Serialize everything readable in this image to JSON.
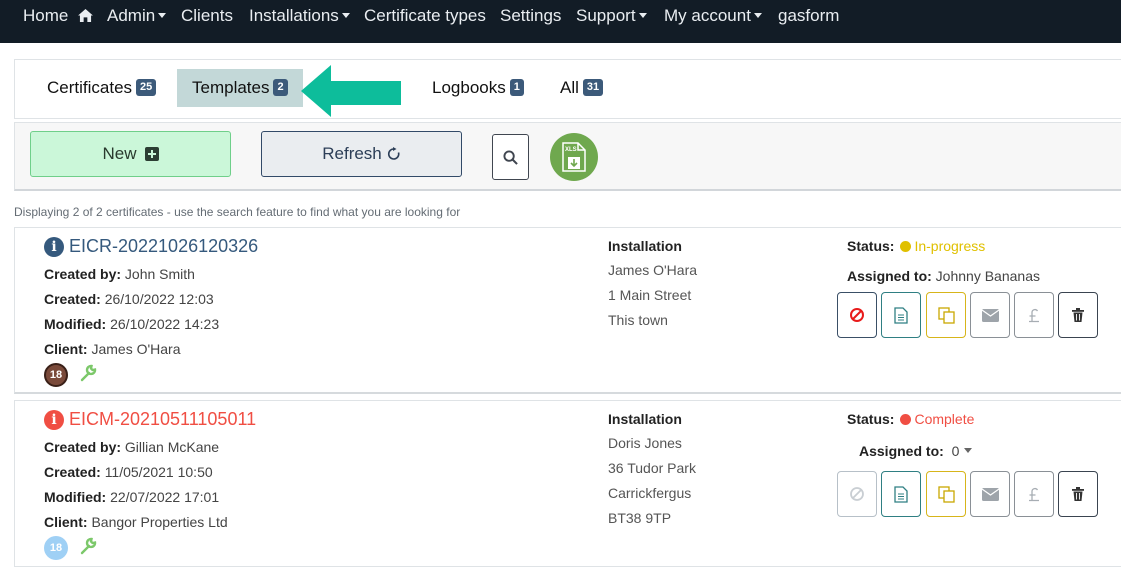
{
  "nav": {
    "home": "Home",
    "admin": "Admin",
    "clients": "Clients",
    "installations": "Installations",
    "certificate_types": "Certificate types",
    "settings": "Settings",
    "support": "Support",
    "my_account": "My account",
    "gasform": "gasform"
  },
  "tabs": [
    {
      "label": "Certificates",
      "count": "25"
    },
    {
      "label": "Templates",
      "count": "2"
    },
    {
      "label": "Logbooks",
      "count": "1"
    },
    {
      "label": "All",
      "count": "31"
    }
  ],
  "toolbar": {
    "new_label": "New",
    "refresh_label": "Refresh",
    "xls_label": "XLS"
  },
  "display_info": "Displaying 2 of 2 certificates - use the search feature to find what you are looking for",
  "labels": {
    "created_by": "Created by:",
    "created": "Created:",
    "modified": "Modified:",
    "client": "Client:",
    "installation": "Installation",
    "status": "Status:",
    "assigned_to": "Assigned to:"
  },
  "certificates": [
    {
      "title": "EICR-20221026120326",
      "created_by": "John Smith",
      "created": "26/10/2022 12:03",
      "modified": "26/10/2022 14:23",
      "client": "James O'Hara",
      "badge": "18",
      "installation": [
        "James O'Hara",
        "1 Main Street",
        "This town"
      ],
      "status": "In-progress",
      "assigned_to": "Johnny Bananas"
    },
    {
      "title": "EICM-20210511105011",
      "created_by": "Gillian McKane",
      "created": "11/05/2021 10:50",
      "modified": "22/07/2022 17:01",
      "client": "Bangor Properties Ltd",
      "badge": "18",
      "installation": [
        "Doris Jones",
        "36 Tudor Park",
        "Carrickfergus",
        "BT38 9TP"
      ],
      "status": "Complete",
      "assigned_to": "0"
    }
  ],
  "colors": {
    "navbar": "#121c26",
    "accent_arrow": "#0dbd9b",
    "in_progress": "#e0c000",
    "complete": "#f04e43",
    "title_blue": "#35597d",
    "title_red": "#f04e43"
  }
}
